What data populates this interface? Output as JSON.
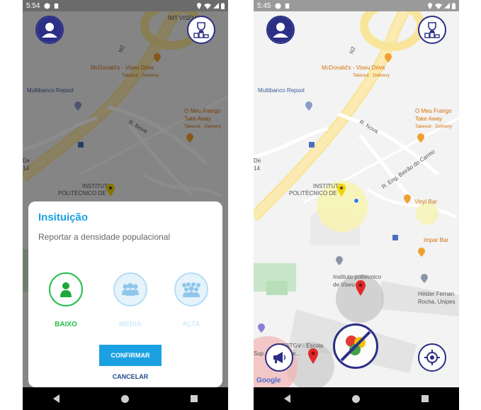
{
  "left_screen": {
    "status_time": "5:54",
    "dialog": {
      "title": "Insituição",
      "message": "Reportar a densidade populacional",
      "levels": [
        {
          "label": "BAIXO",
          "color": "#26c04a",
          "selected": true
        },
        {
          "label": "MÉDIA",
          "color": "#9fd3f2",
          "selected": false
        },
        {
          "label": "ALTA",
          "color": "#9fd3f2",
          "selected": false
        }
      ],
      "confirm_label": "CONFIRMAR",
      "cancel_label": "CANCELAR"
    }
  },
  "right_screen": {
    "status_time": "5:45",
    "google_label": "Google"
  },
  "map_labels": {
    "imt": "IMT VISEU",
    "mcd": "McDonald's - Viseu Drive",
    "mcd_sub": "Takeout · Delivery",
    "multibanco": "Multibanco Repsol",
    "frango1": "O Meu Frango",
    "frango2": "Take Away",
    "frango_sub": "Takeout · Delivery",
    "r_nova": "R. Nova",
    "n2": "N2",
    "de14_1": "De",
    "de14_2": "14",
    "instituto1": "INSTITUTO",
    "instituto2": "POLITÉCNICO DE",
    "eng": "R. Eng. Beirão do Carmo",
    "vinyl": "Vinyl Bar",
    "impar": "Impar Bar",
    "ipv1": "Instituto politécnico",
    "ipv2": "de Viseu",
    "helder1": "Hélder Fernan",
    "helder2": "Rocha, Unipes",
    "estgv1": "ESTGV - Escola",
    "estgv2": "Sup. Tecnolog. e..."
  },
  "colors": {
    "accent": "#1ba1e2",
    "fab_border": "#2b2f86",
    "pin_red": "#e02a2a",
    "pin_yellow": "#f0d400"
  },
  "icons": [
    "avatar-icon",
    "trophy-icon",
    "megaphone-icon",
    "crosshair-icon",
    "traffic-off-icon",
    "person-icon",
    "group-icon",
    "crowd-icon"
  ]
}
